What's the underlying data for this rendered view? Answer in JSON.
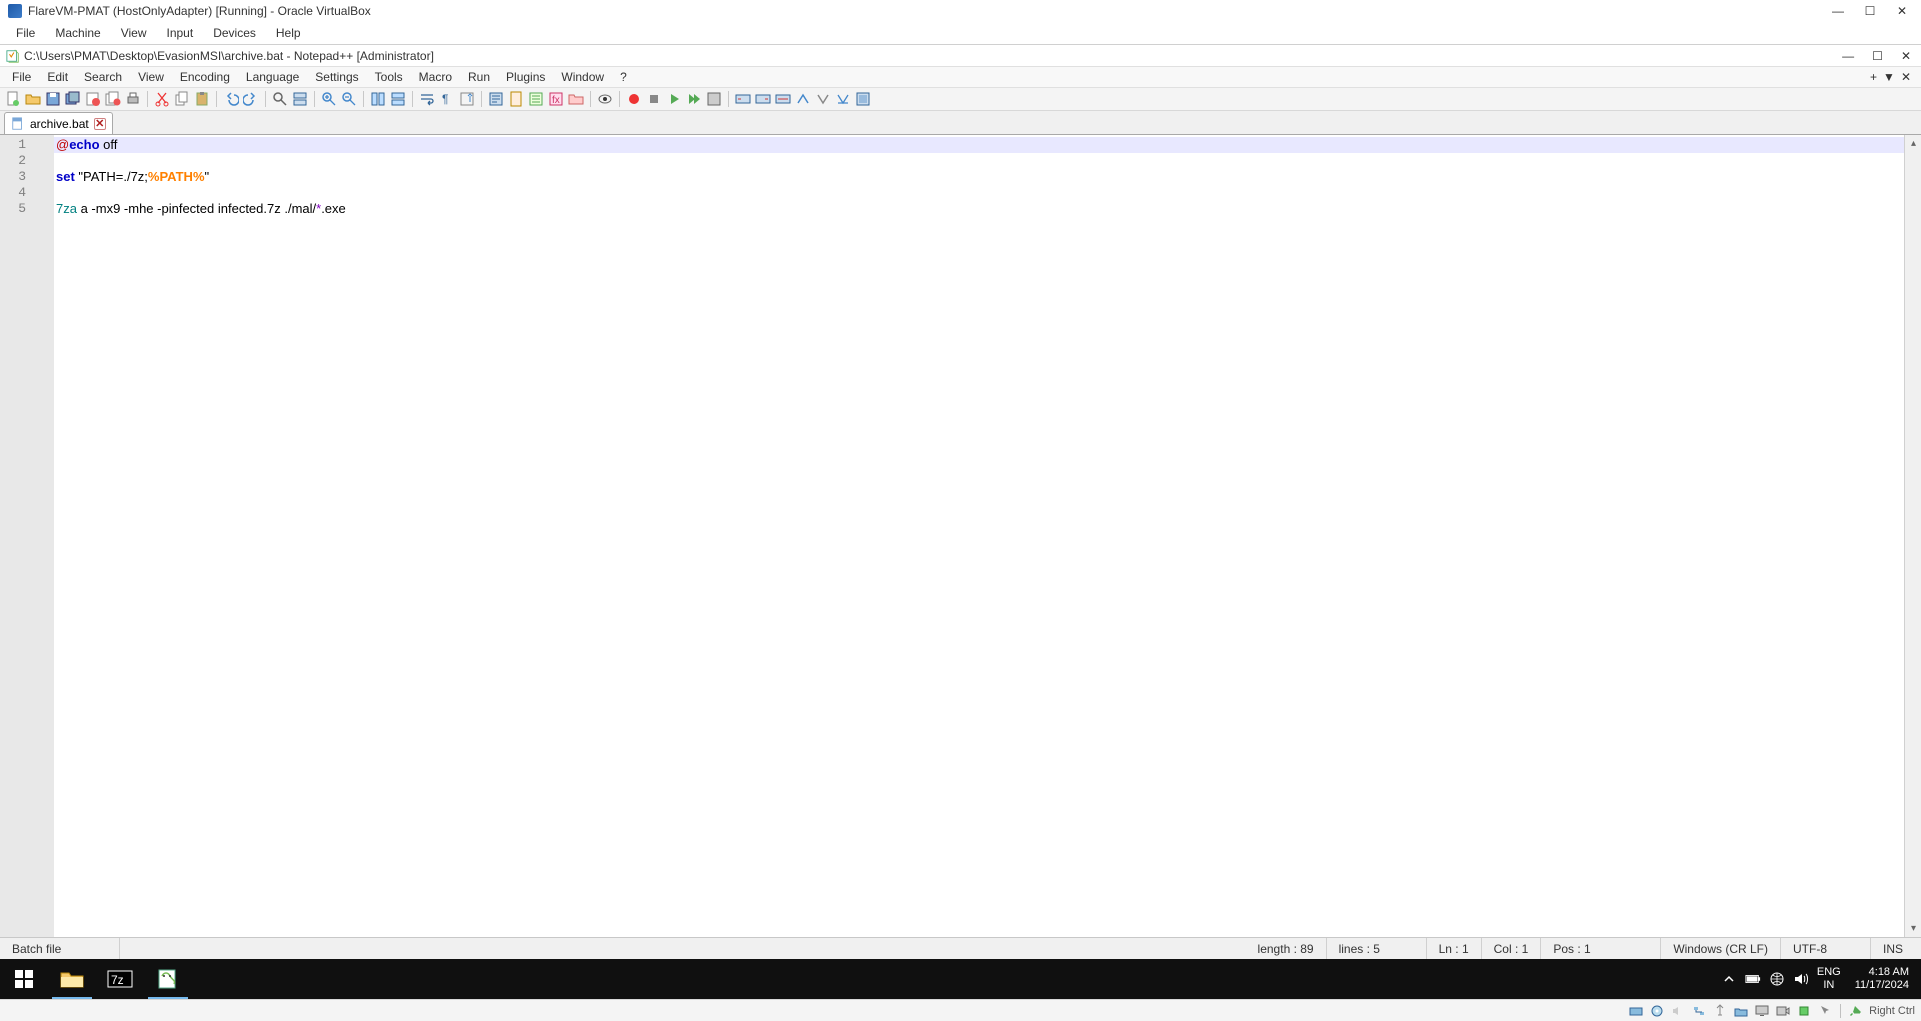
{
  "vbox": {
    "title": "FlareVM-PMAT (HostOnlyAdapter) [Running] - Oracle VirtualBox",
    "menu": [
      "File",
      "Machine",
      "View",
      "Input",
      "Devices",
      "Help"
    ],
    "host_key": "Right Ctrl"
  },
  "npp": {
    "title": "C:\\Users\\PMAT\\Desktop\\EvasionMSI\\archive.bat - Notepad++ [Administrator]",
    "menu": [
      "File",
      "Edit",
      "Search",
      "View",
      "Encoding",
      "Language",
      "Settings",
      "Tools",
      "Macro",
      "Run",
      "Plugins",
      "Window",
      "?"
    ],
    "tab": {
      "label": "archive.bat"
    },
    "status": {
      "type": "Batch file",
      "length": "length : 89",
      "lines": "lines : 5",
      "ln": "Ln : 1",
      "col": "Col : 1",
      "pos": "Pos : 1",
      "eol": "Windows (CR LF)",
      "enc": "UTF-8",
      "ins": "INS"
    }
  },
  "code": {
    "l1": {
      "at": "@",
      "kw": "echo",
      "rest": " off"
    },
    "l3": {
      "kw": "set",
      "q1": " \"PATH=./7z;",
      "var": "%PATH%",
      "q2": "\""
    },
    "l5": {
      "cmd": "7za",
      "mid": " a -mx9 -mhe -pinfected infected.7z ./mal/",
      "wild": "*",
      "ext": ".exe"
    }
  },
  "taskbar": {
    "lang1": "ENG",
    "lang2": "IN",
    "time": "4:18 AM",
    "date": "11/17/2024"
  }
}
